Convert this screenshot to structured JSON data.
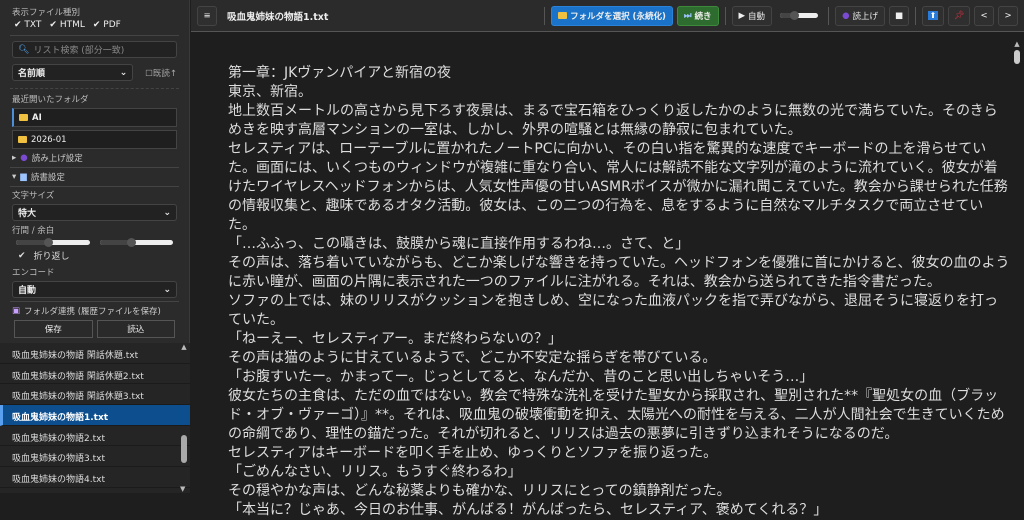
{
  "sidebar": {
    "file_types_label": "表示ファイル種別",
    "file_types": [
      "TXT",
      "HTML",
      "PDF"
    ],
    "search_placeholder": "リスト検索 (部分一致)",
    "sort_value": "名前順",
    "read_label": "既読↑",
    "recent_label": "最近開いたフォルダ",
    "recent_folders": [
      "AI",
      "2026-01"
    ],
    "tts_section": "読み上げ設定",
    "reading_section": "読書設定",
    "font_size_label": "文字サイズ",
    "font_size_value": "特大",
    "spacing_label": "行間 / 余白",
    "line_spacing": 0.45,
    "margin": 0.45,
    "wrap_label": "折り返し",
    "encoding_label": "エンコード",
    "encoding_value": "自動",
    "folder_sync_label": "フォルダ連携 (履歴ファイルを保存)",
    "save_label": "保存",
    "load_label": "読込"
  },
  "files": [
    "吸血鬼姉妹の物語 閑話休題.txt",
    "吸血鬼姉妹の物語 閑話休題2.txt",
    "吸血鬼姉妹の物語 閑話休題3.txt",
    "吸血鬼姉妹の物語1.txt",
    "吸血鬼姉妹の物語2.txt",
    "吸血鬼姉妹の物語3.txt",
    "吸血鬼姉妹の物語4.txt"
  ],
  "selected_file": "吸血鬼姉妹の物語1.txt",
  "toolbar": {
    "title": "吸血鬼姉妹の物語1.txt",
    "menu": "≡",
    "select_folder": "フォルダを選択 (永続化)",
    "continue": "続き",
    "auto": "自動",
    "read_aloud": "読上げ",
    "stop": "■",
    "prev": "<",
    "next": ">",
    "accent": "#1a73c8",
    "continue_color": "#2e6b2e"
  },
  "content": [
    "第一章：JKヴァンパイアと新宿の夜",
    "東京、新宿。",
    "地上数百メートルの高さから見下ろす夜景は、まるで宝石箱をひっくり返したかのように無数の光で満ちていた。そのきらめきを映す高層マンションの一室は、しかし、外界の喧騒とは無縁の静寂に包まれていた。",
    "セレスティアは、ローテーブルに置かれたノートPCに向かい、その白い指を驚異的な速度でキーボードの上を滑らせていた。画面には、いくつものウィンドウが複雑に重なり合い、常人には解読不能な文字列が滝のように流れていく。彼女が着けたワイヤレスヘッドフォンからは、人気女性声優の甘いASMRボイスが微かに漏れ聞こえていた。教会から課せられた任務の情報収集と、趣味であるオタク活動。彼女は、この二つの行為を、息をするように自然なマルチタスクで両立させていた。",
    "「…ふふっ、この囁きは、鼓膜から魂に直接作用するわね…。さて、と」",
    "その声は、落ち着いていながらも、どこか楽しげな響きを持っていた。ヘッドフォンを優雅に首にかけると、彼女の血のように赤い瞳が、画面の片隅に表示された一つのファイルに注がれる。それは、教会から送られてきた指令書だった。",
    "ソファの上では、妹のリリスがクッションを抱きしめ、空になった血液パックを指で弄びながら、退屈そうに寝返りを打っていた。",
    "「ねーえー、セレスティアー。まだ終わらないの？」",
    "その声は猫のように甘えているようで、どこか不安定な揺らぎを帯びている。",
    "「お腹すいたー。かまってー。じっとしてると、なんだか、昔のこと思い出しちゃいそう…」",
    "彼女たちの主食は、ただの血ではない。教会で特殊な洗礼を受けた聖女から採取され、聖別された**『聖処女の血（ブラッド・オブ・ヴァーゴ）』**。それは、吸血鬼の破壊衝動を抑え、太陽光への耐性を与える、二人が人間社会で生きていくための命綱であり、理性の錨だった。それが切れると、リリスは過去の悪夢に引きずり込まれそうになるのだ。",
    "セレスティアはキーボードを叩く手を止め、ゆっくりとソファを振り返った。",
    "「ごめんなさい、リリス。もうすぐ終わるわ」",
    "その穏やかな声は、どんな秘薬よりも確かな、リリスにとっての鎮静剤だった。",
    "「本当に？じゃあ、今日のお仕事、がんばる！がんばったら、セレスティア、褒めてくれる？」"
  ]
}
